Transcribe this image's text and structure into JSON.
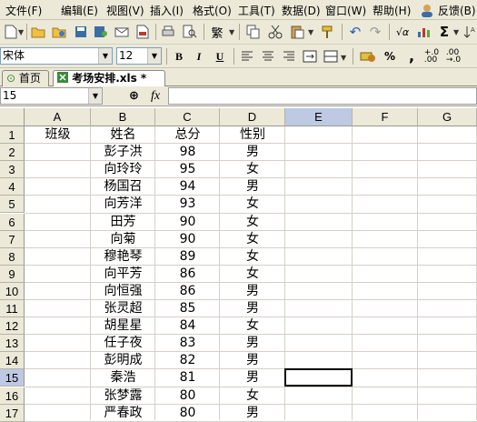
{
  "menu": [
    "文件(F)",
    "编辑(E)",
    "视图(V)",
    "插入(I)",
    "格式(O)",
    "工具(T)",
    "数据(D)",
    "窗口(W)",
    "帮助(H)",
    "反馈(B)"
  ],
  "toolbar": {
    "font_name": "宋体",
    "font_size": "12",
    "sigma": "Σ",
    "bold": "B",
    "italic": "I",
    "underline": "U",
    "percent": "%",
    "comma": ",",
    "fullwidth_symbol": "繁"
  },
  "tabs": [
    {
      "label": "首页",
      "active": false
    },
    {
      "label": "考场安排.xls *",
      "active": true
    }
  ],
  "formula_bar": {
    "name_box": "15",
    "fx": "fx"
  },
  "sheet": {
    "columns": [
      "A",
      "B",
      "C",
      "D",
      "E",
      "F",
      "G"
    ],
    "active_column": "E",
    "active_row": "15",
    "rows": [
      {
        "num": "1",
        "A": "班级",
        "B": "姓名",
        "C": "总分",
        "D": "性别"
      },
      {
        "num": "2",
        "A": "",
        "B": "彭子洪",
        "C": "98",
        "D": "男"
      },
      {
        "num": "3",
        "A": "",
        "B": "向玲玲",
        "C": "95",
        "D": "女"
      },
      {
        "num": "4",
        "A": "",
        "B": "杨国召",
        "C": "94",
        "D": "男"
      },
      {
        "num": "5",
        "A": "",
        "B": "向芳洋",
        "C": "93",
        "D": "女"
      },
      {
        "num": "6",
        "A": "",
        "B": "田芳",
        "C": "90",
        "D": "女"
      },
      {
        "num": "7",
        "A": "",
        "B": "向菊",
        "C": "90",
        "D": "女"
      },
      {
        "num": "8",
        "A": "",
        "B": "穆艳琴",
        "C": "89",
        "D": "女"
      },
      {
        "num": "9",
        "A": "",
        "B": "向平芳",
        "C": "86",
        "D": "女"
      },
      {
        "num": "10",
        "A": "",
        "B": "向恒强",
        "C": "86",
        "D": "男"
      },
      {
        "num": "11",
        "A": "",
        "B": "张灵超",
        "C": "85",
        "D": "男"
      },
      {
        "num": "12",
        "A": "",
        "B": "胡星星",
        "C": "84",
        "D": "女"
      },
      {
        "num": "13",
        "A": "",
        "B": "任子夜",
        "C": "83",
        "D": "男"
      },
      {
        "num": "14",
        "A": "",
        "B": "彭明成",
        "C": "82",
        "D": "男"
      },
      {
        "num": "15",
        "A": "",
        "B": "秦浩",
        "C": "81",
        "D": "男"
      },
      {
        "num": "16",
        "A": "",
        "B": "张梦露",
        "C": "80",
        "D": "女"
      },
      {
        "num": "17",
        "A": "",
        "B": "严春政",
        "C": "80",
        "D": "男"
      }
    ]
  },
  "colors": {
    "chrome": "#ece9d8",
    "active_header": "#bec9e3",
    "gridline": "#d4d0c8"
  }
}
